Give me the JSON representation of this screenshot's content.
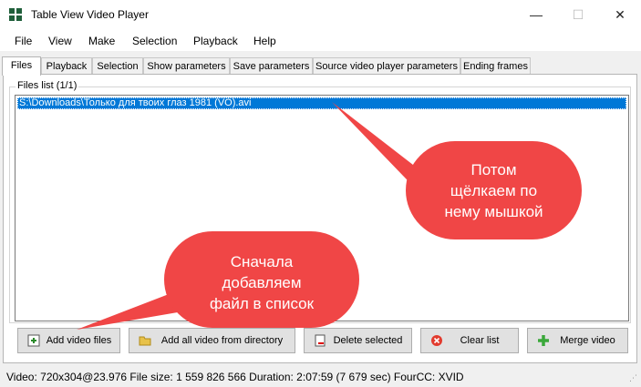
{
  "window": {
    "title": "Table View Video Player",
    "minimize": "—",
    "maximize": "☐",
    "close": "✕"
  },
  "menu": [
    "File",
    "View",
    "Make",
    "Selection",
    "Playback",
    "Help"
  ],
  "tabs": [
    "Files",
    "Playback",
    "Selection",
    "Show parameters",
    "Save parameters",
    "Source video player parameters",
    "Ending frames"
  ],
  "files": {
    "group_label": "Files list (1/1)",
    "items": [
      "S:\\Downloads\\Только для твоих глаз 1981 (VO).avi"
    ]
  },
  "buttons": {
    "add": "Add video files",
    "add_dir": "Add all video from directory",
    "delete": "Delete selected",
    "clear": "Clear list",
    "merge": "Merge video"
  },
  "status": {
    "text": "Video: 720x304@23.976  File size: 1 559 826 566  Duration: 2:07:59 (7 679 sec)  FourCC: XVID",
    "grip": "⋰"
  },
  "callouts": {
    "first": [
      "Сначала",
      "добавляем",
      "файл в список"
    ],
    "second": [
      "Потом",
      "щёлкаем по",
      "нему мышкой"
    ]
  },
  "colors": {
    "selection": "#0078d7",
    "callout": "#f04646"
  }
}
